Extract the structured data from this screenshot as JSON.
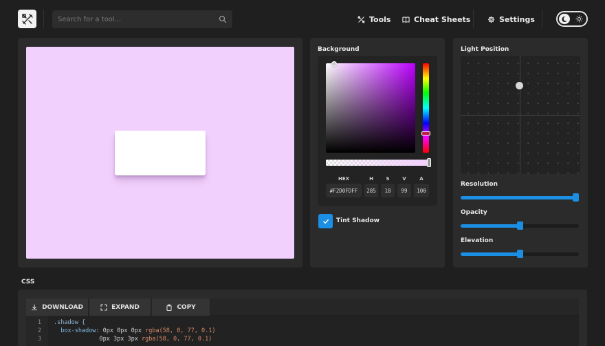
{
  "header": {
    "search_placeholder": "Search for a tool...",
    "nav": [
      {
        "label": "Tools",
        "icon": "tools-icon"
      },
      {
        "label": "Cheat Sheets",
        "icon": "book-icon"
      },
      {
        "label": "Settings",
        "icon": "gear-icon"
      }
    ],
    "theme_toggle": {
      "state": "dark"
    }
  },
  "preview": {
    "background_color": "#F2D0FD",
    "card_color": "#FFFFFF"
  },
  "background_panel": {
    "title": "Background",
    "color_labels": {
      "hex": "HEX",
      "h": "H",
      "s": "S",
      "v": "V",
      "a": "A"
    },
    "color_values": {
      "hex": "#F2D0FDFF",
      "h": "285",
      "s": "18",
      "v": "99",
      "a": "100"
    },
    "tint_shadow_label": "Tint Shadow",
    "tint_shadow_checked": true
  },
  "light_panel": {
    "title": "Light Position",
    "resolution_label": "Resolution",
    "resolution_value": 1.0,
    "opacity_label": "Opacity",
    "opacity_value": 0.5,
    "elevation_label": "Elevation",
    "elevation_value": 0.5
  },
  "css_section": {
    "heading": "CSS",
    "tabs": [
      {
        "label": "DOWNLOAD",
        "icon": "download-icon"
      },
      {
        "label": "EXPAND",
        "icon": "expand-icon"
      },
      {
        "label": "COPY",
        "icon": "copy-icon"
      }
    ],
    "line_numbers": [
      "1",
      "2",
      "3"
    ],
    "code": {
      "selector": ".shadow {",
      "line2_prop": "box-shadow:",
      "line2_vals": "0px 0px 0px",
      "line2_fn": "rgba(58, 0, 77, 0.1)",
      "line3_vals": "0px 3px 3px",
      "line3_fn": "rgba(58, 0, 77, 0.1)"
    }
  },
  "accent_color": "#1A8FE3"
}
